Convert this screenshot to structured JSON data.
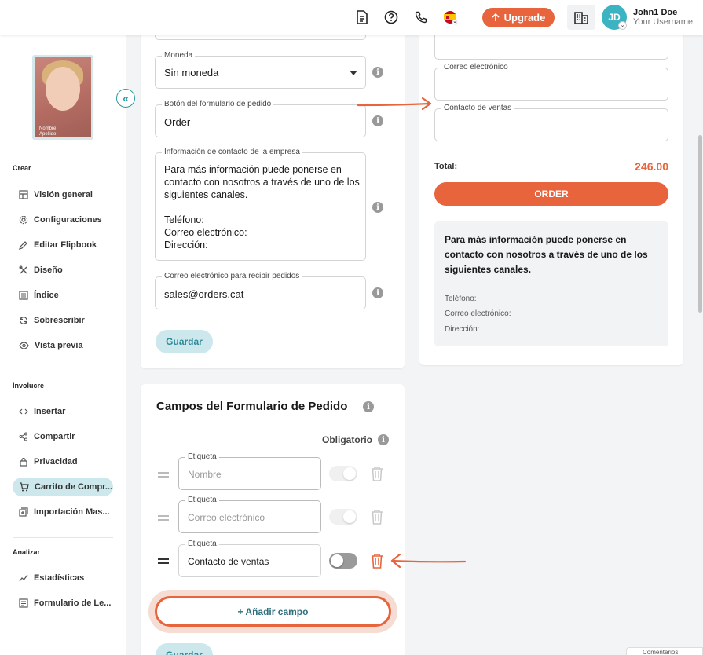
{
  "header": {
    "upgrade_label": "Upgrade",
    "avatar_initials": "JD",
    "user_name": "John1 Doe",
    "user_sub": "Your Username"
  },
  "sidebar": {
    "section_create": "Crear",
    "create_items": [
      {
        "label": "Visión general"
      },
      {
        "label": "Configuraciones"
      },
      {
        "label": "Editar Flipbook"
      },
      {
        "label": "Diseño"
      },
      {
        "label": "Índice"
      },
      {
        "label": "Sobrescribir"
      },
      {
        "label": "Vista previa"
      }
    ],
    "section_involve": "Involucre",
    "involve_items": [
      {
        "label": "Insertar"
      },
      {
        "label": "Compartir"
      },
      {
        "label": "Privacidad"
      },
      {
        "label": "Carrito de Compr..."
      },
      {
        "label": "Importación Mas..."
      }
    ],
    "section_analyze": "Analizar",
    "analyze_items": [
      {
        "label": "Estadísticas"
      },
      {
        "label": "Formulario de Le..."
      }
    ],
    "cover_text": "Nombre Apellido"
  },
  "settings": {
    "currency_label": "Moneda",
    "currency_value": "Sin moneda",
    "order_button_label": "Botón del formulario de pedido",
    "order_button_value": "Order",
    "contact_label": "Información de contacto de la empresa",
    "contact_lines": [
      "Para más información puede ponerse en",
      "contacto con nosotros a través de uno de los",
      "siguientes canales.",
      "",
      "Teléfono:",
      "Correo electrónico:",
      "Dirección:"
    ],
    "email_label": "Correo electrónico para recibir pedidos",
    "email_value": "sales@orders.cat",
    "save_label": "Guardar"
  },
  "preview": {
    "email_label": "Correo electrónico",
    "sales_label": "Contacto de ventas",
    "total_label": "Total:",
    "total_value": "246.00",
    "order_label": "ORDER",
    "info_lines": [
      "Para más información puede ponerse en",
      "contacto con nosotros a través de uno de los",
      "siguientes canales."
    ],
    "phone": "Teléfono:",
    "email": "Correo electrónico:",
    "address": "Dirección:"
  },
  "form_fields": {
    "title": "Campos del Formulario de Pedido",
    "required_label": "Obligatorio",
    "rows": [
      {
        "label": "Etiqueta",
        "value": "Nombre",
        "required": true
      },
      {
        "label": "Etiqueta",
        "value": "Correo electrónico",
        "required": true
      },
      {
        "label": "Etiqueta",
        "value": "Contacto de ventas",
        "required": false
      }
    ],
    "add_label": "+ Añadir campo",
    "save_label": "Guardar"
  },
  "colors": {
    "accent": "#e8643c",
    "teal": "#2e9aa6",
    "teal_light": "#cde8ec"
  },
  "footer_tab": "Comentarios"
}
